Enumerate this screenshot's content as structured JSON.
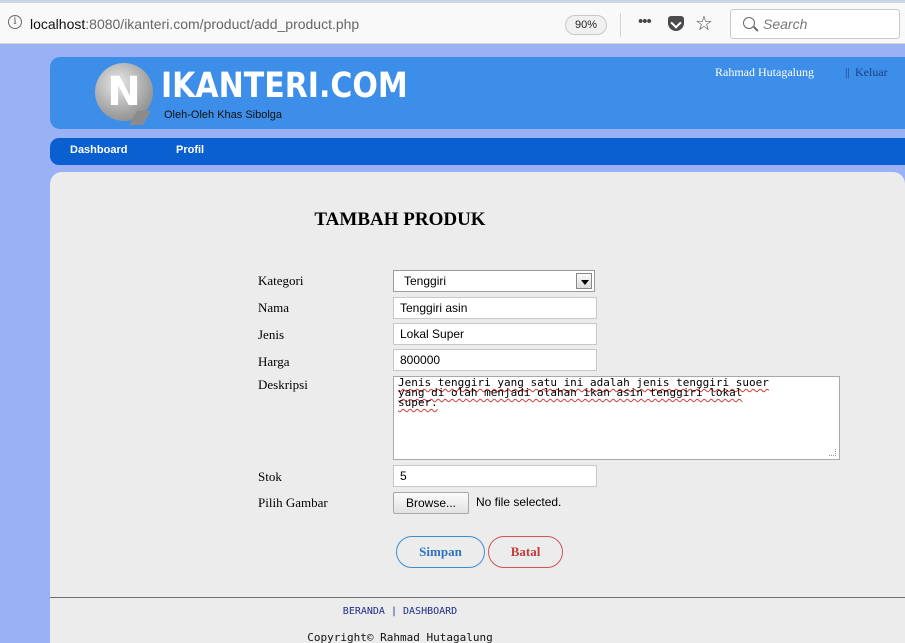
{
  "browser": {
    "url_host": "localhost",
    "url_rest": ":8080/ikanteri.com/product/add_product.php",
    "zoom": "90%",
    "more_glyph": "•••",
    "bookmark_glyph": "☆",
    "search_placeholder": "Search"
  },
  "header": {
    "logo_letter": "N",
    "site_title": "IKANTERI.COM",
    "tagline": "Oleh-Oleh Khas Sibolga",
    "user_name": "Rahmad Hutagalung",
    "separator": "||",
    "logout": "Keluar"
  },
  "nav": {
    "items": [
      "Dashboard",
      "Profil"
    ]
  },
  "form": {
    "title": "TAMBAH PRODUK",
    "labels": {
      "kategori": "Kategori",
      "nama": "Nama",
      "jenis": "Jenis",
      "harga": "Harga",
      "deskripsi": "Deskripsi",
      "stok": "Stok",
      "gambar": "Pilih Gambar"
    },
    "values": {
      "kategori": "Tenggiri",
      "nama": "Tenggiri asin",
      "jenis": "Lokal Super",
      "harga": "800000",
      "deskripsi_lines": [
        "Jenis tenggiri yang satu ini adalah jenis tenggiri suoer",
        "yang di olah menjadi olahan ikan asin tenggiri lokal",
        "super."
      ],
      "stok": "5"
    },
    "browse_label": "Browse...",
    "file_status": "No file selected.",
    "save_label": "Simpan",
    "cancel_label": "Batal"
  },
  "footer": {
    "link_beranda": "BERANDA",
    "link_sep": " | ",
    "link_dashboard": "DASHBOARD",
    "copyright": "Copyright© Rahmad Hutagalung"
  },
  "colors": {
    "page_background": "#9ab2f5",
    "header": "#3d8ee8",
    "nav": "#0a5fd1",
    "panel": "#ececec",
    "save_accent": "#2f73bf",
    "cancel_accent": "#c43b3b"
  }
}
